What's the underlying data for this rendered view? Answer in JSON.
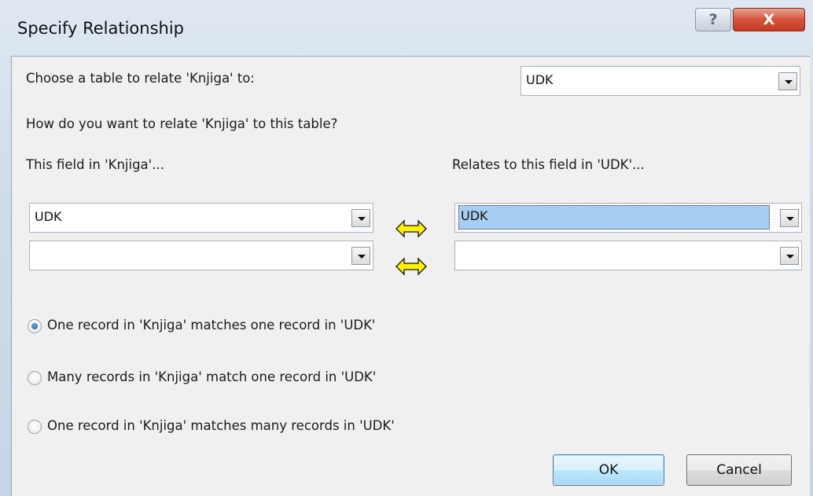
{
  "window": {
    "title": "Specify Relationship",
    "help_label": "?",
    "close_label": "X"
  },
  "relate_table": {
    "label": "Choose a table to relate 'Knjiga' to:",
    "value": "UDK"
  },
  "question": "How do you want to relate 'Knjiga' to this table?",
  "fields": {
    "left_header": "This field in 'Knjiga'...",
    "right_header": "Relates to this field in 'UDK'...",
    "rows": [
      {
        "left": "UDK",
        "right": "UDK"
      },
      {
        "left": "",
        "right": ""
      }
    ]
  },
  "options": [
    {
      "label": "One record in 'Knjiga' matches one record in 'UDK'",
      "checked": true
    },
    {
      "label": "Many records in 'Knjiga' match one record in 'UDK'",
      "checked": false
    },
    {
      "label": "One record in 'Knjiga' matches many records in 'UDK'",
      "checked": false
    }
  ],
  "buttons": {
    "ok": "OK",
    "cancel": "Cancel"
  },
  "icons": {
    "help": "help-icon",
    "close": "close-icon",
    "link_arrow": "double-arrow-icon",
    "dropdown": "chevron-down-icon"
  },
  "colors": {
    "selection": "#a8cdf2",
    "arrow_fill": "#fff200",
    "close_button": "#c43a22"
  }
}
